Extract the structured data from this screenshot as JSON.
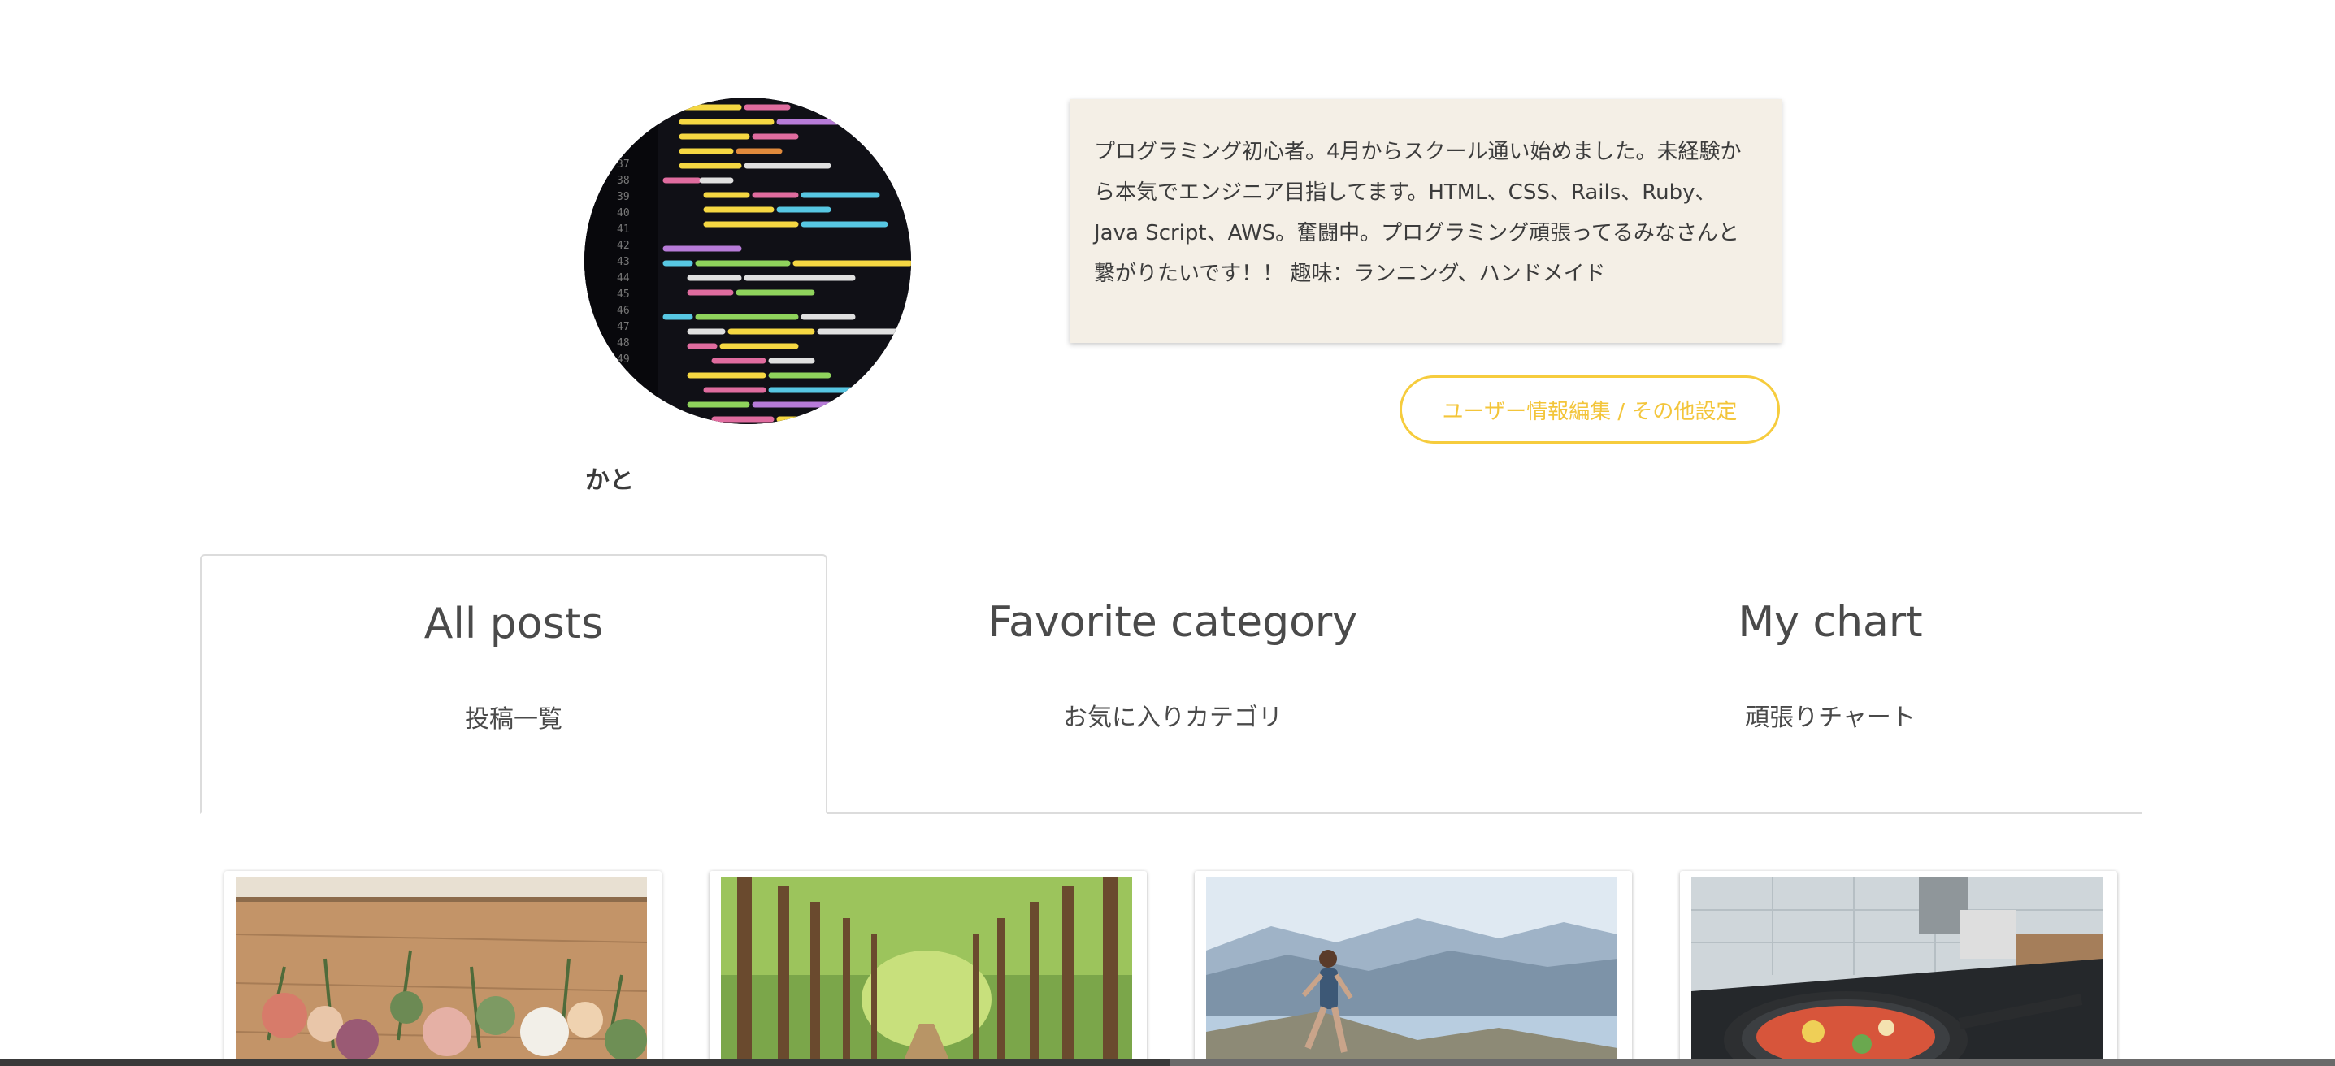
{
  "profile": {
    "username": "かと",
    "avatar_icon": "code-screen-avatar",
    "bio": "プログラミング初心者。4月からスクール通い始めました。未経験から本気でエンジニア目指してます。HTML、CSS、Rails、Ruby、Java Script、AWS。奮闘中。プログラミング頑張ってるみなさんと繋がりたいです！！ 趣味：ランニング、ハンドメイド",
    "edit_button_label": "ユーザー情報編集 / その他設定"
  },
  "tabs": [
    {
      "title": "All posts",
      "subtitle": "投稿一覧",
      "active": true
    },
    {
      "title": "Favorite category",
      "subtitle": "お気に入りカテゴリ",
      "active": false
    },
    {
      "title": "My chart",
      "subtitle": "頑張りチャート",
      "active": false
    }
  ],
  "posts": [
    {
      "image": "flowers-on-wooden-table"
    },
    {
      "image": "tree-lined-forest-path"
    },
    {
      "image": "runner-by-mountain-lake"
    },
    {
      "image": "frying-pan-on-stove"
    }
  ],
  "colors": {
    "accent_yellow": "#f6cc3d",
    "bio_background": "#f4efe6",
    "border_gray": "#dcdcdc"
  }
}
